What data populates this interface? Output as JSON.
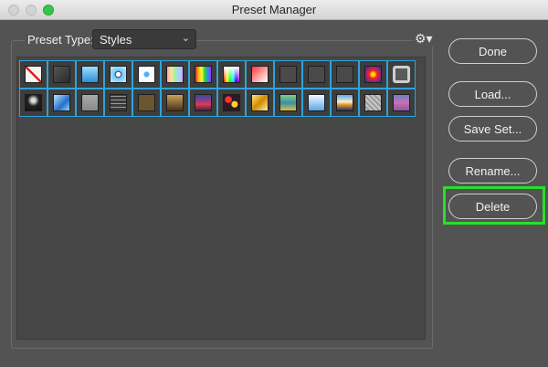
{
  "window": {
    "title": "Preset Manager"
  },
  "preset_type": {
    "label": "Preset Type:",
    "selected": "Styles"
  },
  "buttons": {
    "done": "Done",
    "load": "Load...",
    "save_set": "Save Set...",
    "rename": "Rename...",
    "delete": "Delete"
  },
  "icons": {
    "settings": "gear-icon",
    "dropdown": "chevron-down-icon"
  },
  "colors": {
    "selection_border": "#2fa3d9",
    "highlight": "#27e02b"
  },
  "styles_row1": [
    "no-style",
    "dark-gray",
    "blue-gradient",
    "blue-dot",
    "white-dot",
    "pastel-rainbow",
    "rainbow-stripes",
    "spectrum",
    "red-white",
    "gray",
    "gray",
    "gray",
    "radial-red-blue",
    "gray-frame"
  ],
  "styles_row2": [
    "black-spot",
    "blue-swirl",
    "light-gray",
    "gray-scratched",
    "brown",
    "brown-gradient",
    "purple-red-stripes",
    "splash",
    "gold",
    "green-yellow-gradient",
    "sky-blue",
    "sunset",
    "silver-texture",
    "violet-stripes"
  ]
}
